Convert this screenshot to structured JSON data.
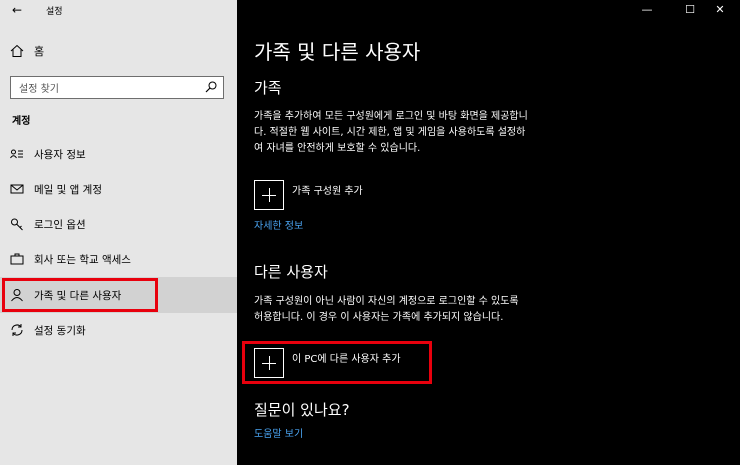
{
  "window": {
    "title": "설정",
    "controls": {
      "minimize": "—",
      "maximize": "☐",
      "close": "✕"
    }
  },
  "sidebar": {
    "back_icon": "←",
    "home_label": "홈",
    "search_placeholder": "설정 찾기",
    "section_label": "계정",
    "items": [
      {
        "label": "사용자 정보",
        "icon": "person-card-icon"
      },
      {
        "label": "메일 및 앱 계정",
        "icon": "mail-icon"
      },
      {
        "label": "로그인 옵션",
        "icon": "key-icon"
      },
      {
        "label": "회사 또는 학교 액세스",
        "icon": "briefcase-icon"
      },
      {
        "label": "가족 및 다른 사용자",
        "icon": "person-icon",
        "active": true
      },
      {
        "label": "설정 동기화",
        "icon": "sync-icon"
      }
    ]
  },
  "main": {
    "title": "가족 및 다른 사용자",
    "family": {
      "heading": "가족",
      "description_lines": [
        "가족을 추가하여 모든 구성원에게 로그인 및 바탕 화면을 제공합니",
        "다. 적절한 웹 사이트, 시간 제한, 앱 및 게임을 사용하도록 설정하",
        "여 자녀를 안전하게 보호할 수 있습니다."
      ],
      "add_label": "가족 구성원 추가",
      "link": "자세한 정보"
    },
    "other_users": {
      "heading": "다른 사용자",
      "description_lines": [
        "가족 구성원이 아닌 사람이 자신의 계정으로 로그인할 수 있도록",
        "허용합니다. 이 경우 이 사용자는 가족에 추가되지 않습니다."
      ],
      "add_label": "이 PC에 다른 사용자 추가"
    },
    "help": {
      "heading": "질문이 있나요?",
      "link": "도움말 보기"
    }
  },
  "colors": {
    "sidebar_bg": "#e6e6e6",
    "main_bg": "#000000",
    "accent_link": "#4aa3f0",
    "highlight": "#e8000d"
  }
}
